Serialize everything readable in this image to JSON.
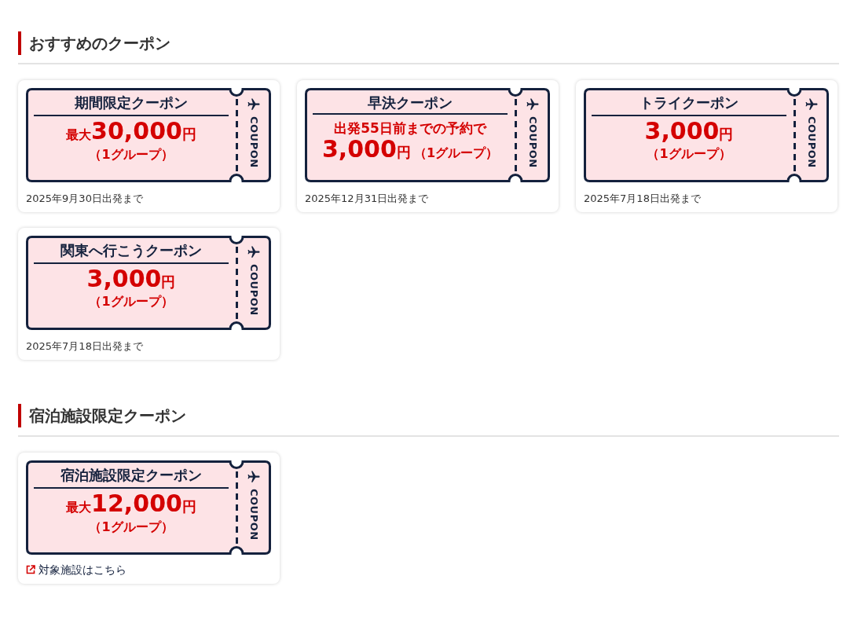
{
  "sections": [
    {
      "heading": "おすすめのクーポン",
      "coupons": [
        {
          "kind": "simple",
          "title": "期間限定クーポン",
          "prefix": "最大",
          "amount": "30,000",
          "unit": "円",
          "group": "（1グループ）",
          "stub": "COUPON",
          "footer": {
            "kind": "note",
            "text": "2025年9月30日出発まで"
          }
        },
        {
          "kind": "condition",
          "title": "早決クーポン",
          "condition": "出発55日前までの予約で",
          "amount": "3,000",
          "unit": "円",
          "group": "（1グループ）",
          "stub": "COUPON",
          "footer": {
            "kind": "note",
            "text": "2025年12月31日出発まで"
          }
        },
        {
          "kind": "simple",
          "title": "トライクーポン",
          "amount": "3,000",
          "unit": "円",
          "group": "（1グループ）",
          "stub": "COUPON",
          "footer": {
            "kind": "note",
            "text": "2025年7月18日出発まで"
          }
        },
        {
          "kind": "simple",
          "title": "関東へ行こうクーポン",
          "amount": "3,000",
          "unit": "円",
          "group": "（1グループ）",
          "stub": "COUPON",
          "footer": {
            "kind": "note",
            "text": "2025年7月18日出発まで"
          }
        }
      ]
    },
    {
      "heading": "宿泊施設限定クーポン",
      "coupons": [
        {
          "kind": "simple",
          "title": "宿泊施設限定クーポン",
          "prefix": "最大",
          "amount": "12,000",
          "unit": "円",
          "group": "（1グループ）",
          "stub": "COUPON",
          "footer": {
            "kind": "link",
            "text": "対象施設はこちら"
          }
        }
      ]
    }
  ]
}
